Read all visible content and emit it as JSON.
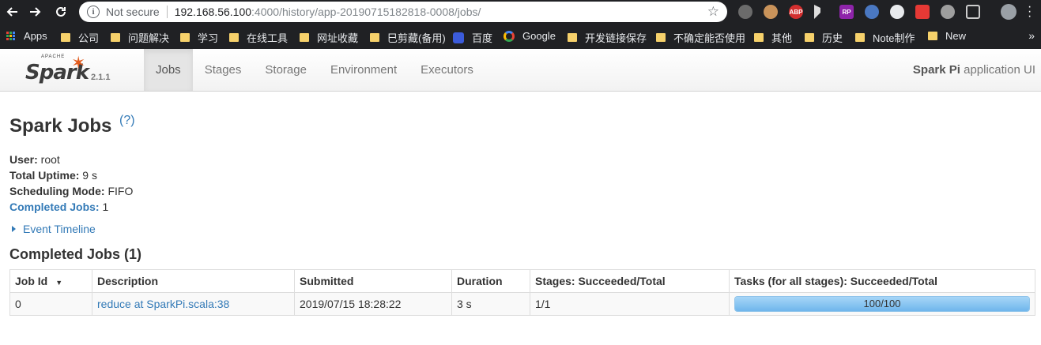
{
  "browser": {
    "address_security": "Not secure",
    "url_host": "192.168.56.100",
    "url_path": ":4000/history/app-20190715182818-0008/jobs/"
  },
  "bookmarks": [
    {
      "label": "Apps",
      "icon": "apps-grid-icon"
    },
    {
      "label": "公司",
      "icon": "folder-icon"
    },
    {
      "label": "问题解决",
      "icon": "folder-icon"
    },
    {
      "label": "学习",
      "icon": "folder-icon"
    },
    {
      "label": "在线工具",
      "icon": "folder-icon"
    },
    {
      "label": "网址收藏",
      "icon": "folder-icon"
    },
    {
      "label": "巳剪藏(备用)",
      "icon": "folder-icon"
    },
    {
      "label": "百度",
      "icon": "baidu-paw-icon"
    },
    {
      "label": "Google",
      "icon": "google-g-icon"
    },
    {
      "label": "开发链接保存",
      "icon": "folder-icon"
    },
    {
      "label": "不确定能否使用",
      "icon": "folder-icon"
    },
    {
      "label": "其他",
      "icon": "folder-icon"
    },
    {
      "label": "历史",
      "icon": "folder-icon"
    },
    {
      "label": "Note制作",
      "icon": "folder-icon"
    },
    {
      "label": "New",
      "icon": "folder-icon"
    }
  ],
  "extensions": {
    "abp_label": "ABP",
    "rp_label": "RP"
  },
  "spark": {
    "logo_apache": "APACHE",
    "logo_word": "Spark",
    "version": "2.1.1",
    "tabs": [
      "Jobs",
      "Stages",
      "Storage",
      "Environment",
      "Executors"
    ],
    "active_tab": "Jobs",
    "app_name": "Spark Pi",
    "app_suffix": " application UI"
  },
  "page": {
    "title": "Spark Jobs",
    "help": "(?)",
    "summary": {
      "user_label": "User:",
      "user_value": " root",
      "uptime_label": "Total Uptime:",
      "uptime_value": " 9 s",
      "mode_label": "Scheduling Mode:",
      "mode_value": " FIFO",
      "completed_label": "Completed Jobs:",
      "completed_value": " 1"
    },
    "event_timeline": "Event Timeline",
    "section_title": "Completed Jobs (1)"
  },
  "table": {
    "headers": [
      "Job Id",
      "Description",
      "Submitted",
      "Duration",
      "Stages: Succeeded/Total",
      "Tasks (for all stages): Succeeded/Total"
    ],
    "sort_indicator": "▼",
    "rows": [
      {
        "job_id": "0",
        "description": "reduce at SparkPi.scala:38",
        "submitted": "2019/07/15 18:28:22",
        "duration": "3 s",
        "stages": "1/1",
        "tasks": "100/100",
        "tasks_fraction": 1.0
      }
    ]
  },
  "colors": {
    "link": "#337ab7",
    "spark_orange": "#e25a1c",
    "progress_fill": "#6fb6ec"
  }
}
